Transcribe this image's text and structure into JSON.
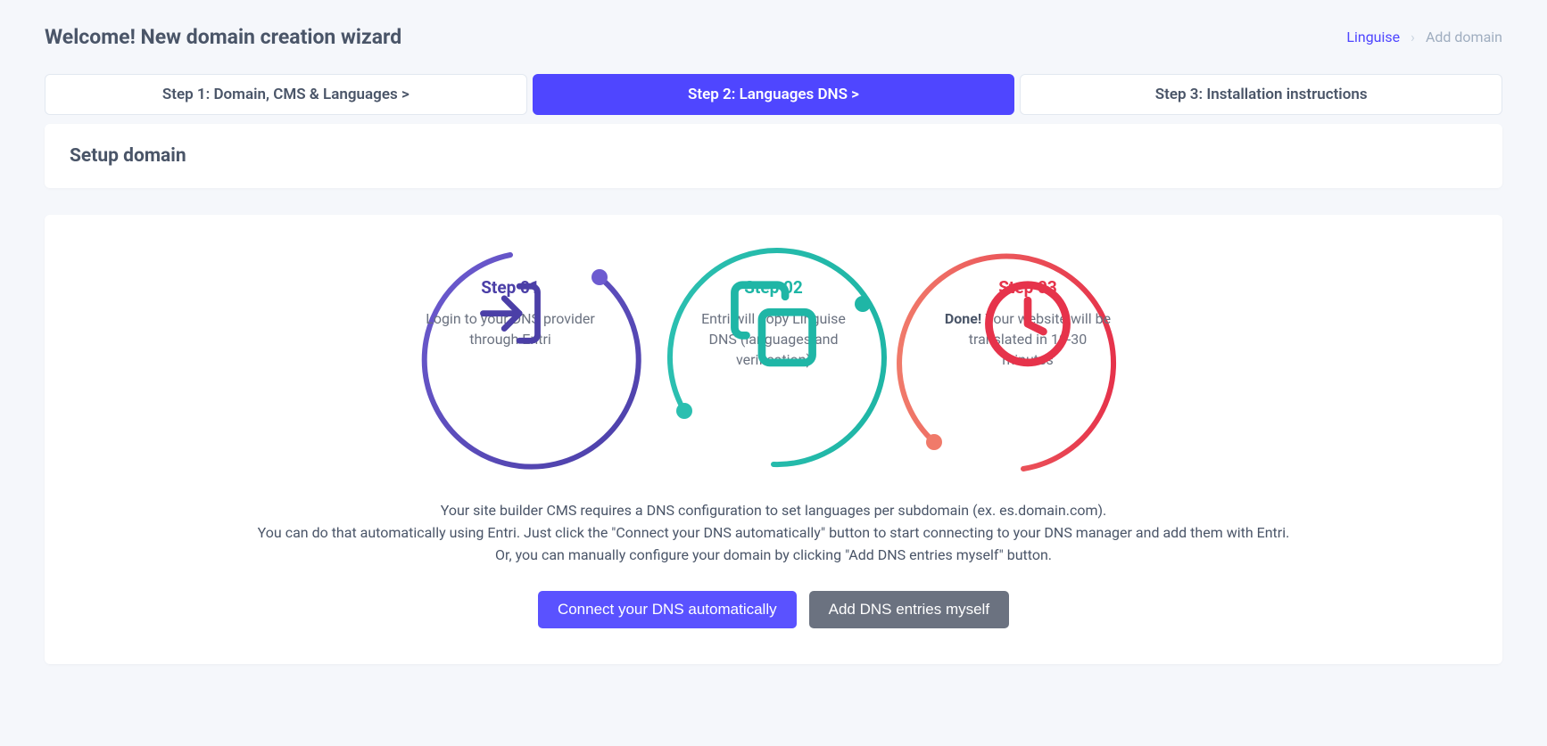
{
  "header": {
    "title": "Welcome! New domain creation wizard"
  },
  "breadcrumb": {
    "link": "Linguise",
    "current": "Add domain"
  },
  "tabs": {
    "step1": "Step 1: Domain, CMS & Languages  >",
    "step2": "Step 2: Languages DNS  >",
    "step3": "Step 3: Installation instructions"
  },
  "panel": {
    "title": "Setup domain"
  },
  "steps": {
    "s1": {
      "label": "Step 01",
      "desc": "Login to your DNS provider through Entri"
    },
    "s2": {
      "label": "Step 02",
      "desc": "Entri will copy Linguise DNS (languages and verification)"
    },
    "s3": {
      "label": "Step 03",
      "bold": "Done!",
      "rest": " Your website will be translated in 10-30 minutes"
    }
  },
  "info": {
    "line1": "Your site builder CMS requires a DNS configuration to set languages per subdomain (ex. es.domain.com).",
    "line2": "You can do that automatically using Entri. Just click the \"Connect your DNS automatically\" button to start connecting to your DNS manager and add them with Entri.",
    "line3": "Or, you can manually configure your domain by clicking \"Add DNS entries myself\" button."
  },
  "buttons": {
    "connect": "Connect your DNS automatically",
    "manual": "Add DNS entries myself"
  }
}
